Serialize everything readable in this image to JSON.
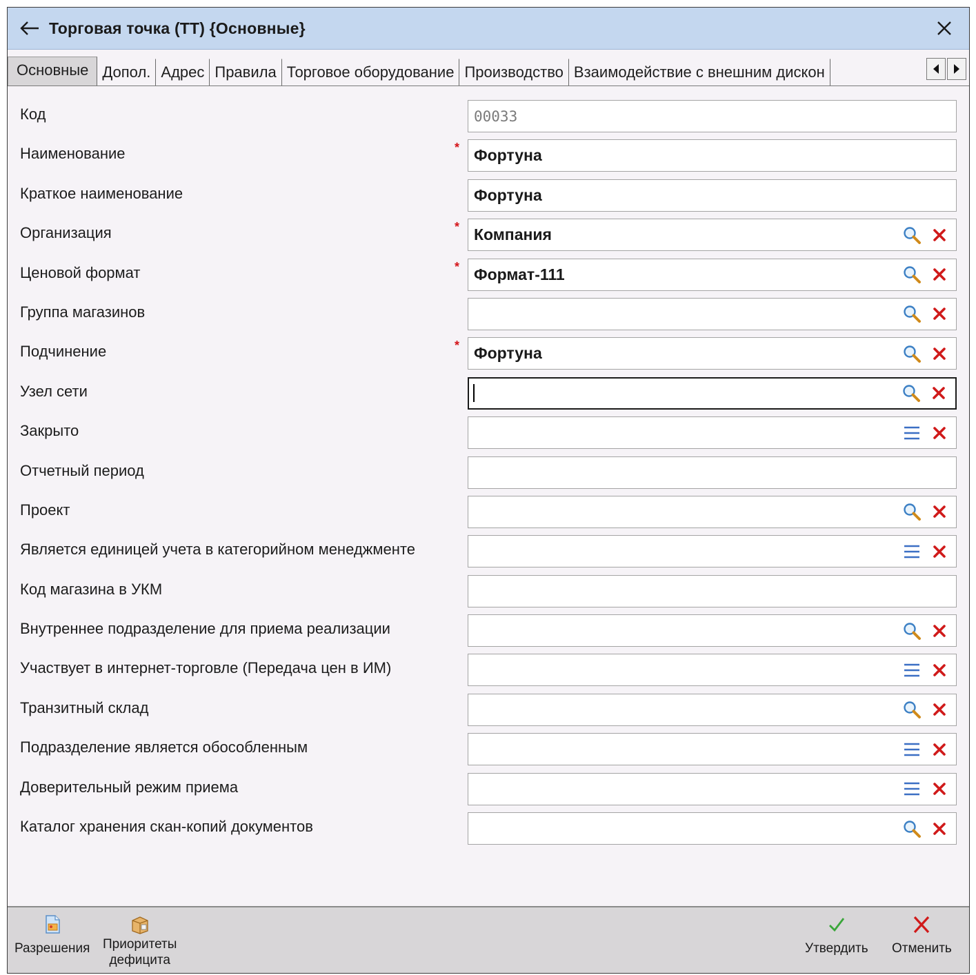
{
  "window": {
    "title": "Торговая точка (ТТ) {Основные}"
  },
  "tabs": [
    {
      "label": "Основные",
      "active": true
    },
    {
      "label": "Допол.",
      "active": false
    },
    {
      "label": "Адрес",
      "active": false
    },
    {
      "label": "Правила",
      "active": false
    },
    {
      "label": "Торговое оборудование",
      "active": false
    },
    {
      "label": "Производство",
      "active": false
    },
    {
      "label": "Взаимодействие с внешним дискон",
      "active": false
    }
  ],
  "fields": [
    {
      "label": "Код",
      "value": "00033",
      "required": false,
      "readonly": true,
      "buttons": []
    },
    {
      "label": "Наименование",
      "value": "Фортуна",
      "required": true,
      "buttons": []
    },
    {
      "label": "Краткое наименование",
      "value": "Фортуна",
      "required": false,
      "buttons": []
    },
    {
      "label": "Организация",
      "value": "Компания",
      "required": true,
      "buttons": [
        "search",
        "clear"
      ]
    },
    {
      "label": "Ценовой формат",
      "value": "Формат-111",
      "required": true,
      "buttons": [
        "search",
        "clear"
      ]
    },
    {
      "label": "Группа магазинов",
      "value": "",
      "required": false,
      "buttons": [
        "search",
        "clear"
      ]
    },
    {
      "label": "Подчинение",
      "value": "Фортуна",
      "required": true,
      "buttons": [
        "search",
        "clear"
      ]
    },
    {
      "label": "Узел сети",
      "value": "",
      "required": false,
      "focused": true,
      "buttons": [
        "search",
        "clear"
      ]
    },
    {
      "label": "Закрыто",
      "value": "",
      "required": false,
      "buttons": [
        "list",
        "clear"
      ]
    },
    {
      "label": "Отчетный период",
      "value": "",
      "required": false,
      "buttons": []
    },
    {
      "label": "Проект",
      "value": "",
      "required": false,
      "buttons": [
        "search",
        "clear"
      ]
    },
    {
      "label": "Является единицей учета в категорийном менеджменте",
      "value": "",
      "required": false,
      "buttons": [
        "list",
        "clear"
      ]
    },
    {
      "label": "Код магазина в УКМ",
      "value": "",
      "required": false,
      "buttons": []
    },
    {
      "label": "Внутреннее подразделение для приема реализации",
      "value": "",
      "required": false,
      "buttons": [
        "search",
        "clear"
      ]
    },
    {
      "label": "Участвует в интернет-торговле (Передача цен в ИМ)",
      "value": "",
      "required": false,
      "buttons": [
        "list",
        "clear"
      ]
    },
    {
      "label": "Транзитный склад",
      "value": "",
      "required": false,
      "buttons": [
        "search",
        "clear"
      ]
    },
    {
      "label": "Подразделение является обособленным",
      "value": "",
      "required": false,
      "buttons": [
        "list",
        "clear"
      ]
    },
    {
      "label": "Доверительный режим приема",
      "value": "",
      "required": false,
      "buttons": [
        "list",
        "clear"
      ]
    },
    {
      "label": "Каталог хранения скан-копий документов",
      "value": "",
      "required": false,
      "buttons": [
        "search",
        "clear"
      ]
    }
  ],
  "required_mark": "*",
  "footer": {
    "permissions_label": "Разрешения",
    "priorities_label_line1": "Приоритеты",
    "priorities_label_line2": "дефицита",
    "approve_label": "Утвердить",
    "cancel_label": "Отменить"
  },
  "colors": {
    "titlebar": "#c4d7ef",
    "required": "#d4141a",
    "search_icon": "#3b7fc4",
    "clear_icon": "#d01a1a",
    "approve_icon": "#3aa63a"
  }
}
